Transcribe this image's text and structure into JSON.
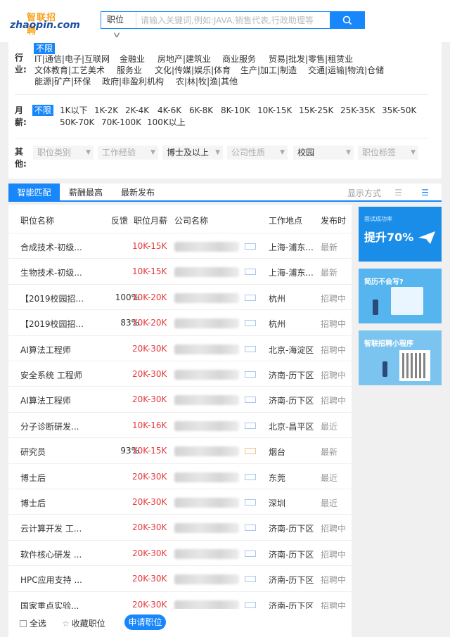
{
  "header": {
    "logo_cn": "智联招聘",
    "logo_en": "zhaopin.com",
    "search_category": "职位",
    "search_placeholder": "请输入关键词,例如:JAVA,销售代表,行政助理等"
  },
  "filters": {
    "industry": {
      "label": "行业:",
      "options": [
        "不限",
        "IT|通信|电子|互联网",
        "金融业",
        "房地产|建筑业",
        "商业服务",
        "贸易|批发|零售|租赁业",
        "文体教育|工艺美术",
        "服务业",
        "文化|传媒|娱乐|体育",
        "生产|加工|制造",
        "交通|运输|物流|仓储",
        "能源|矿产|环保",
        "政府|非盈利机构",
        "农|林|牧|渔|其他"
      ]
    },
    "salary": {
      "label": "月薪:",
      "options": [
        "不限",
        "1K以下",
        "1K-2K",
        "2K-4K",
        "4K-6K",
        "6K-8K",
        "8K-10K",
        "10K-15K",
        "15K-25K",
        "25K-35K",
        "35K-50K",
        "50K-70K",
        "70K-100K",
        "100K以上"
      ]
    },
    "other": {
      "label": "其他:",
      "dropdowns": [
        "职位类别",
        "工作经验",
        "博士及以上",
        "公司性质",
        "校园",
        "职位标签"
      ]
    }
  },
  "tabs": [
    "智能匹配",
    "薪酬最高",
    "最新发布"
  ],
  "view_mode_label": "显示方式",
  "table": {
    "headers": [
      "职位名称",
      "反馈",
      "职位月薪",
      "公司名称",
      "工作地点",
      "发布时"
    ],
    "rows": [
      {
        "title": "合成技术-初级...",
        "feedback": "",
        "salary": "10K-15K",
        "location": "上海-浦东...",
        "posted": "最新"
      },
      {
        "title": "生物技术-初级...",
        "feedback": "",
        "salary": "10K-15K",
        "location": "上海-浦东...",
        "posted": "最新"
      },
      {
        "title": "【2019校园招...",
        "feedback": "100%",
        "salary": "10K-20K",
        "location": "杭州",
        "posted": "招聘中"
      },
      {
        "title": "【2019校园招...",
        "feedback": "83%",
        "salary": "10K-20K",
        "location": "杭州",
        "posted": "招聘中"
      },
      {
        "title": "AI算法工程师",
        "feedback": "",
        "salary": "20K-30K",
        "location": "北京-海淀区",
        "posted": "招聘中"
      },
      {
        "title": "安全系统 工程师",
        "feedback": "",
        "salary": "20K-30K",
        "location": "济南-历下区",
        "posted": "招聘中"
      },
      {
        "title": "AI算法工程师",
        "feedback": "",
        "salary": "20K-30K",
        "location": "济南-历下区",
        "posted": "招聘中"
      },
      {
        "title": "分子诊断研发...",
        "feedback": "",
        "salary": "10K-16K",
        "location": "北京-昌平区",
        "posted": "最近"
      },
      {
        "title": "研究员",
        "feedback": "93%",
        "salary": "10K-15K",
        "location": "烟台",
        "posted": "最新"
      },
      {
        "title": "博士后",
        "feedback": "",
        "salary": "20K-30K",
        "location": "东莞",
        "posted": "最近"
      },
      {
        "title": "博士后",
        "feedback": "",
        "salary": "20K-30K",
        "location": "深圳",
        "posted": "最近"
      },
      {
        "title": "云计算开发 工...",
        "feedback": "",
        "salary": "20K-30K",
        "location": "济南-历下区",
        "posted": "招聘中"
      },
      {
        "title": "软件核心研发 ...",
        "feedback": "",
        "salary": "20K-30K",
        "location": "济南-历下区",
        "posted": "招聘中"
      },
      {
        "title": "HPC应用支持 ...",
        "feedback": "",
        "salary": "20K-30K",
        "location": "济南-历下区",
        "posted": "招聘中"
      },
      {
        "title": "国家重点实验...",
        "feedback": "",
        "salary": "20K-30K",
        "location": "济南-历下区",
        "posted": "招聘中"
      }
    ]
  },
  "side_ads": [
    {
      "title": "提升70%",
      "subtitle": "面试成功率"
    },
    {
      "title": "简历不会写?",
      "subtitle": ""
    },
    {
      "title": "智联招聘小程序",
      "subtitle": ""
    }
  ],
  "footer": {
    "select_all": "全选",
    "favorite": "收藏职位",
    "apply": "申请职位"
  },
  "colors": {
    "accent": "#1787fb",
    "salary": "#e5383b"
  }
}
